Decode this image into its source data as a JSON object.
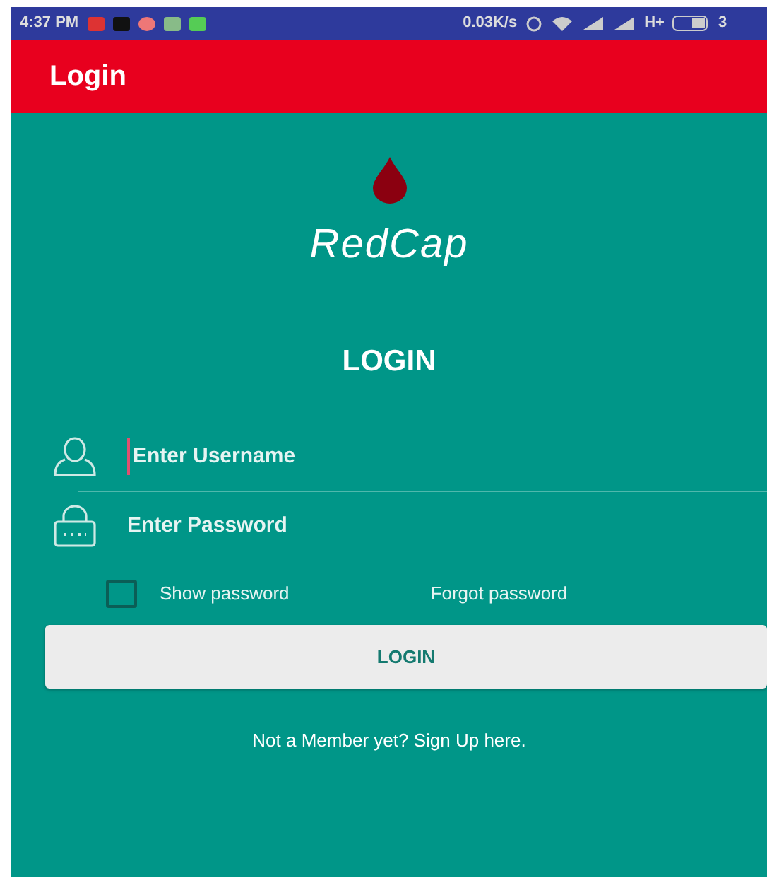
{
  "status_bar": {
    "time": "4:37 PM",
    "speed": "0.03K/s",
    "network": "H+",
    "battery": "3"
  },
  "app_bar": {
    "title": "Login"
  },
  "logo": {
    "name": "RedCap"
  },
  "heading": "LOGIN",
  "fields": [
    {
      "kind": "username",
      "placeholder": "Enter Username",
      "focused": true
    },
    {
      "kind": "password",
      "placeholder": "Enter Password",
      "focused": false
    }
  ],
  "show_password": {
    "label": "Show password",
    "checked": false
  },
  "forgot_link": "Forgot password",
  "login_button": "LOGIN",
  "signup_text": "Not a Member yet? Sign Up here."
}
